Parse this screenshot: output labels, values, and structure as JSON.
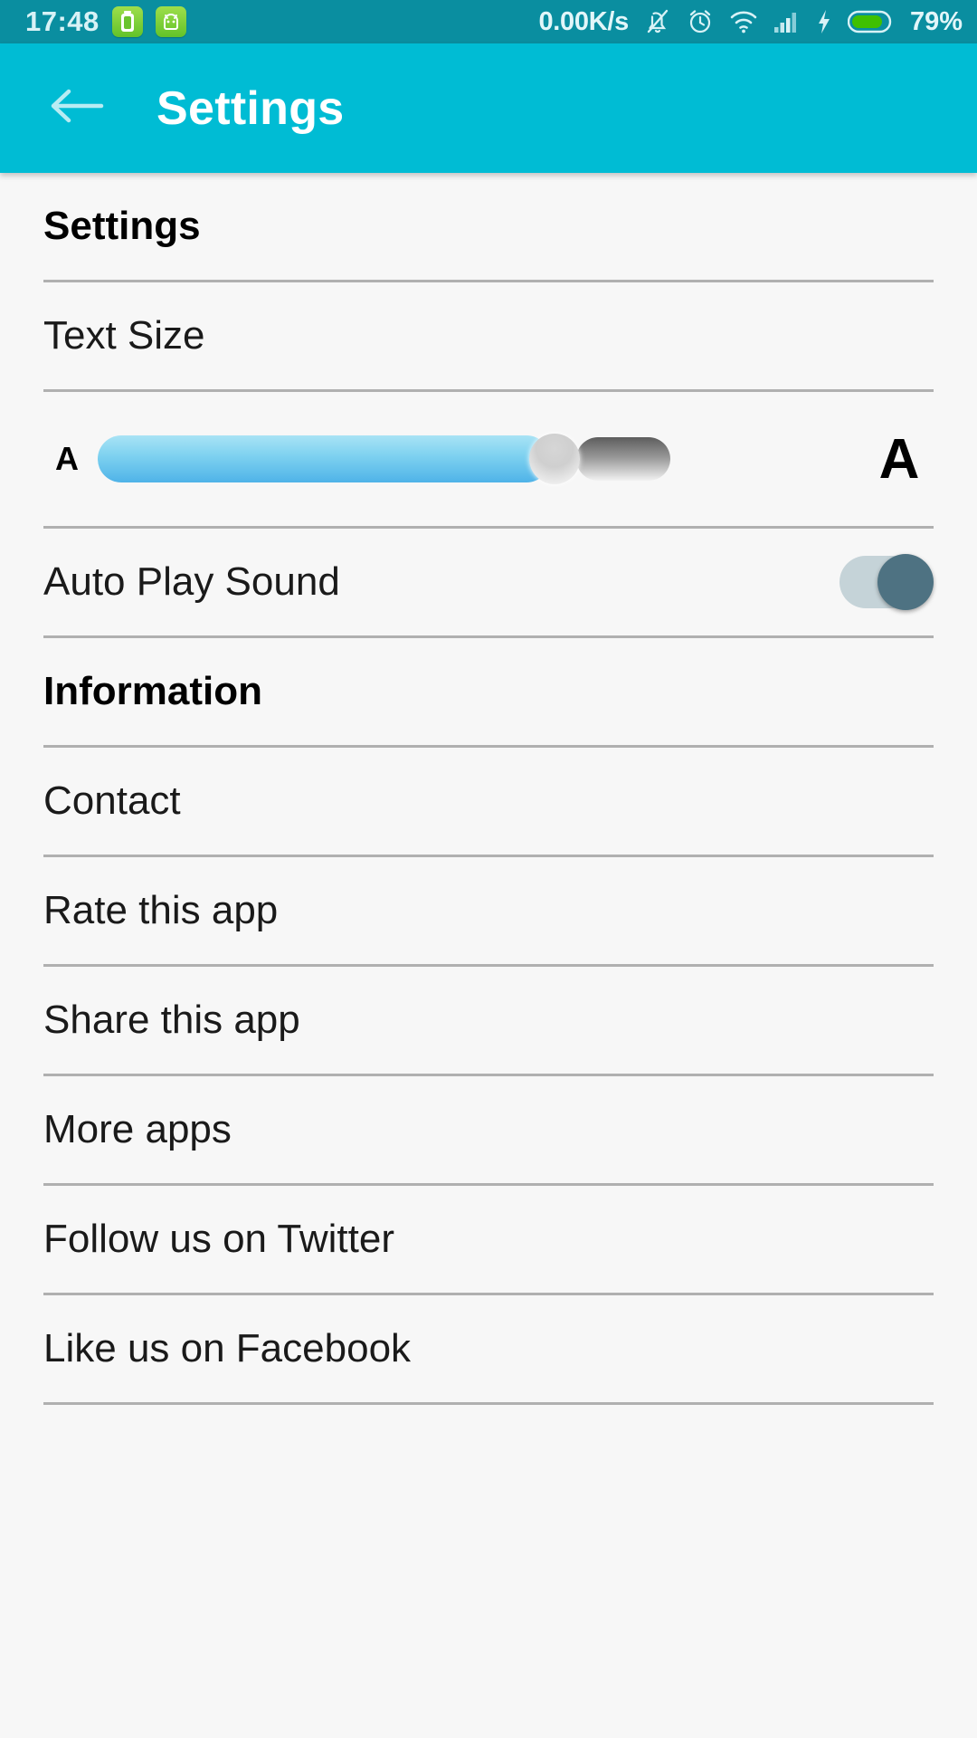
{
  "statusbar": {
    "time": "17:48",
    "network_speed": "0.00K/s",
    "battery_percent": "79%",
    "icons": {
      "app_battery": "battery-app-icon",
      "app_android": "android-robot-icon",
      "silent": "bell-muted-icon",
      "alarm": "alarm-clock-icon",
      "wifi": "wifi-icon",
      "signal": "signal-bars-icon",
      "charging": "charging-bolt-icon",
      "battery": "battery-icon"
    },
    "colors": {
      "background": "#0a8ea0",
      "text": "#d8f2f6",
      "battery_fill": "#3fc000"
    }
  },
  "appbar": {
    "title": "Settings",
    "back_icon": "back-arrow-icon",
    "colors": {
      "background": "#00bcd4",
      "title": "#ffffff"
    }
  },
  "sections": [
    {
      "header": "Settings",
      "rows": [
        {
          "label": "Text Size",
          "type": "label"
        },
        {
          "type": "slider",
          "small_label": "A",
          "large_label": "A",
          "value_percent": 60
        },
        {
          "label": "Auto Play Sound",
          "type": "toggle",
          "checked": true
        }
      ]
    },
    {
      "header": "Information",
      "rows": [
        {
          "label": "Contact",
          "type": "link"
        },
        {
          "label": "Rate this app",
          "type": "link"
        },
        {
          "label": "Share this app",
          "type": "link"
        },
        {
          "label": "More apps",
          "type": "link"
        },
        {
          "label": "Follow us on Twitter",
          "type": "link"
        },
        {
          "label": "Like us on Facebook",
          "type": "link"
        }
      ]
    }
  ],
  "colors": {
    "page_background": "#f7f7f7",
    "divider": "#b0b0b0",
    "slider_fill": "#7fd2f0",
    "toggle_track": "#c5d3d8",
    "toggle_thumb": "#4e7282"
  }
}
